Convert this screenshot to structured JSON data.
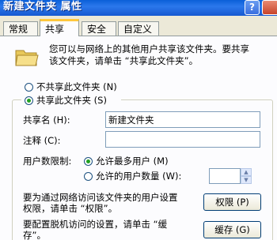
{
  "window": {
    "title": "新建文件夹 属性",
    "help_label": "?"
  },
  "tabs": [
    {
      "label": "常规"
    },
    {
      "label": "共享"
    },
    {
      "label": "安全"
    },
    {
      "label": "自定义"
    }
  ],
  "info": {
    "line1": "您可以与网络上的其他用户共享该文件夹。要共享",
    "line2": "该文件夹，请单击 “共享此文件夹”。"
  },
  "share_options": {
    "no_share_label": "不共享此文件夹 (N)",
    "share_label": "共享此文件夹 (S)",
    "selected": "share"
  },
  "fields": {
    "share_name_label": "共享名 (H):",
    "share_name_value": "新建文件夹",
    "comment_label": "注释 (C):",
    "comment_value": "",
    "user_limit_label": "用户数限制:",
    "max_users_label": "允许最多用户 (M)",
    "allowed_users_label": "允许的用户数量 (W):",
    "user_limit_selected": "max"
  },
  "permissions": {
    "text_line1": "要为通过网络访问该文件夹的用户设置",
    "text_line2": "权限，请单击 “权限”。",
    "button_label": "权限 (P)"
  },
  "caching": {
    "text_line1": "要配置脱机访问的设置，请单击 “缓",
    "text_line2": "存”。",
    "button_label": "缓存 (G)"
  }
}
